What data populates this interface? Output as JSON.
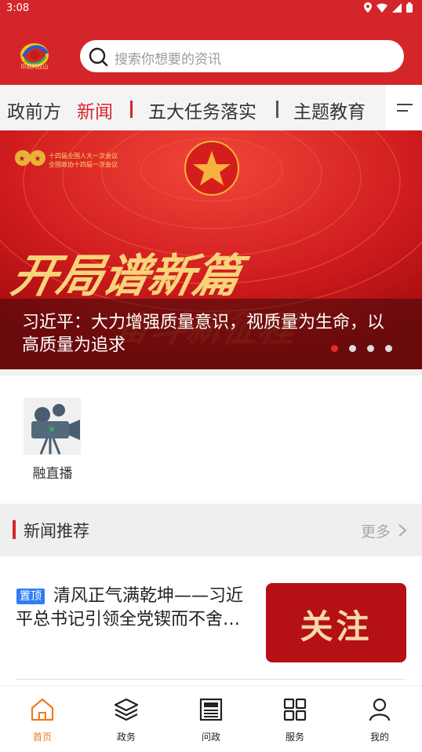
{
  "status_bar": {
    "time": "3:08"
  },
  "header": {
    "logo_text": "印刻阿拉山",
    "search_placeholder": "搜索你想要的资讯"
  },
  "tabs": [
    {
      "label": "政前方",
      "active": false
    },
    {
      "label": "新闻",
      "active": true
    },
    {
      "label": "五大任务落实",
      "active": false
    },
    {
      "label": "主题教育",
      "active": false
    }
  ],
  "banner": {
    "top_label_line1": "十四届全国人大一次会议",
    "top_label_line2": "全国政协十四届一次会议",
    "headline_art": "开局谱新篇",
    "headline_art2": "奋斗新征程",
    "title": "习近平：大力增强质量意识，视质量为生命，以高质量为追求",
    "dots_total": 4,
    "dots_active": 0
  },
  "shortcuts": [
    {
      "label": "融直播",
      "icon": "camera-icon"
    }
  ],
  "recommend": {
    "title": "新闻推荐",
    "more": "更多"
  },
  "news": [
    {
      "badge": "置顶",
      "title": "清风正气满乾坤——习近平总书记引领全党锲而不舍…",
      "thumb_text": "关注"
    }
  ],
  "bottom_nav": [
    {
      "label": "首页",
      "icon": "home-icon",
      "active": true
    },
    {
      "label": "政务",
      "icon": "layers-icon",
      "active": false
    },
    {
      "label": "问政",
      "icon": "newspaper-icon",
      "active": false
    },
    {
      "label": "服务",
      "icon": "grid-icon",
      "active": false
    },
    {
      "label": "我的",
      "icon": "user-icon",
      "active": false
    }
  ],
  "colors": {
    "brand_red": "#d4262a",
    "nav_active": "#f07a1e",
    "pin_blue": "#2f7cf6"
  }
}
